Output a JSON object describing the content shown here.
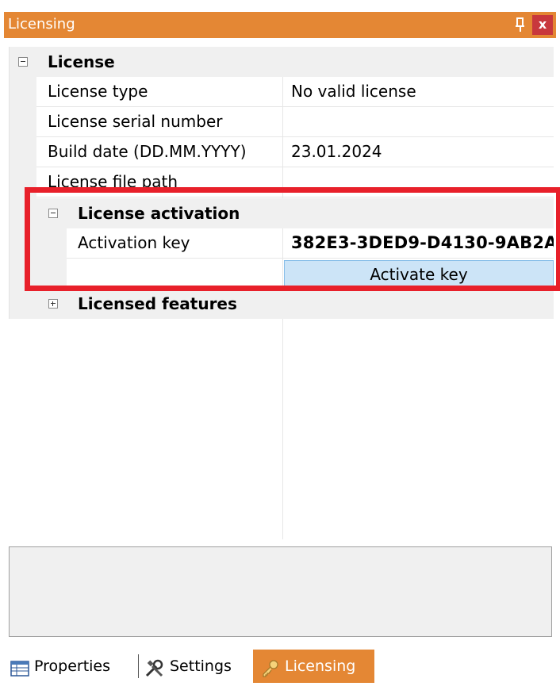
{
  "panel": {
    "title": "Licensing",
    "pin_icon": "pin-icon",
    "close_label": "x",
    "header_color": "#e48734"
  },
  "grid": {
    "license_category": "License",
    "rows": [
      {
        "name": "License type",
        "value": "No valid license"
      },
      {
        "name": "License serial number",
        "value": ""
      },
      {
        "name": "Build date (DD.MM.YYYY)",
        "value": "23.01.2024"
      },
      {
        "name": "License file path",
        "value": ""
      }
    ],
    "activation_category": "License activation",
    "activation_key_label": "Activation key",
    "activation_key_value": "382E3-3DED9-D4130-9AB2A",
    "activate_button_label": "Activate key",
    "licensed_features_category": "Licensed features",
    "highlight_color": "#e8202a"
  },
  "tabs": [
    {
      "label": "Properties",
      "icon": "table-icon"
    },
    {
      "label": "Settings",
      "icon": "tools-icon"
    },
    {
      "label": "Licensing",
      "icon": "key-icon",
      "active": true
    }
  ]
}
